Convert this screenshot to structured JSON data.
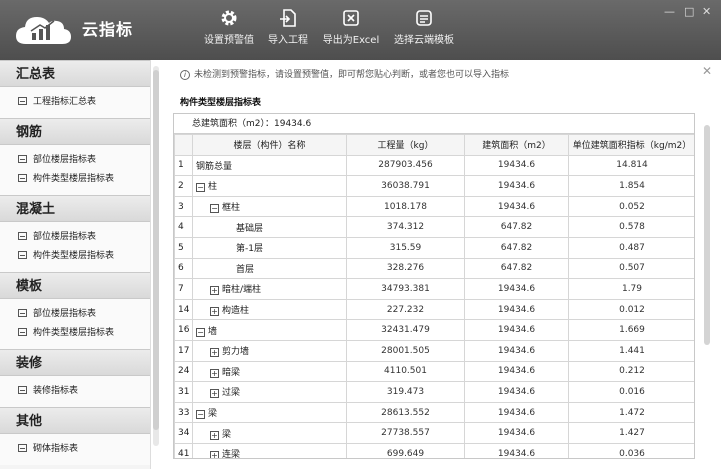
{
  "app": {
    "name": "云指标"
  },
  "toolbar": [
    {
      "label": "设置预警值",
      "icon": "gear-icon"
    },
    {
      "label": "导入工程",
      "icon": "import-icon"
    },
    {
      "label": "导出为Excel",
      "icon": "export-excel-icon"
    },
    {
      "label": "选择云端模板",
      "icon": "template-icon"
    }
  ],
  "sidebar": {
    "sections": [
      {
        "title": "汇总表",
        "items": [
          "工程指标汇总表"
        ]
      },
      {
        "title": "钢筋",
        "items": [
          "部位楼层指标表",
          "构件类型楼层指标表"
        ]
      },
      {
        "title": "混凝土",
        "items": [
          "部位楼层指标表",
          "构件类型楼层指标表"
        ]
      },
      {
        "title": "模板",
        "items": [
          "部位楼层指标表",
          "构件类型楼层指标表"
        ]
      },
      {
        "title": "装修",
        "items": [
          "装修指标表"
        ]
      },
      {
        "title": "其他",
        "items": [
          "砌体指标表"
        ]
      }
    ]
  },
  "main": {
    "notice": "未检测到预警指标，请设置预警值，即可帮您贴心判断，或者您也可以导入指标",
    "section_title": "构件类型楼层指标表",
    "total_area": "总建筑面积（m2）：19434.6",
    "table": {
      "headers": [
        "楼层（构件）名称",
        "工程量（kg）",
        "建筑面积（m2）",
        "单位建筑面积指标（kg/m2）"
      ],
      "rows": [
        {
          "idx": "1",
          "level": 0,
          "toggle": "",
          "name": "钢筋总量",
          "qty": "287903.456",
          "area": "19434.6",
          "index": "14.814"
        },
        {
          "idx": "2",
          "level": 0,
          "toggle": "−",
          "name": "柱",
          "qty": "36038.791",
          "area": "19434.6",
          "index": "1.854"
        },
        {
          "idx": "3",
          "level": 1,
          "toggle": "−",
          "name": "框柱",
          "qty": "1018.178",
          "area": "19434.6",
          "index": "0.052"
        },
        {
          "idx": "4",
          "level": 2,
          "toggle": "",
          "name": "基础层",
          "qty": "374.312",
          "area": "647.82",
          "index": "0.578"
        },
        {
          "idx": "5",
          "level": 2,
          "toggle": "",
          "name": "第-1层",
          "qty": "315.59",
          "area": "647.82",
          "index": "0.487"
        },
        {
          "idx": "6",
          "level": 2,
          "toggle": "",
          "name": "首层",
          "qty": "328.276",
          "area": "647.82",
          "index": "0.507"
        },
        {
          "idx": "7",
          "level": 1,
          "toggle": "+",
          "name": "暗柱/端柱",
          "qty": "34793.381",
          "area": "19434.6",
          "index": "1.79"
        },
        {
          "idx": "14",
          "level": 1,
          "toggle": "+",
          "name": "构造柱",
          "qty": "227.232",
          "area": "19434.6",
          "index": "0.012"
        },
        {
          "idx": "16",
          "level": 0,
          "toggle": "−",
          "name": "墙",
          "qty": "32431.479",
          "area": "19434.6",
          "index": "1.669"
        },
        {
          "idx": "17",
          "level": 1,
          "toggle": "+",
          "name": "剪力墙",
          "qty": "28001.505",
          "area": "19434.6",
          "index": "1.441"
        },
        {
          "idx": "24",
          "level": 1,
          "toggle": "+",
          "name": "暗梁",
          "qty": "4110.501",
          "area": "19434.6",
          "index": "0.212"
        },
        {
          "idx": "31",
          "level": 1,
          "toggle": "+",
          "name": "过梁",
          "qty": "319.473",
          "area": "19434.6",
          "index": "0.016"
        },
        {
          "idx": "33",
          "level": 0,
          "toggle": "−",
          "name": "梁",
          "qty": "28613.552",
          "area": "19434.6",
          "index": "1.472"
        },
        {
          "idx": "34",
          "level": 1,
          "toggle": "+",
          "name": "梁",
          "qty": "27738.557",
          "area": "19434.6",
          "index": "1.427"
        },
        {
          "idx": "41",
          "level": 1,
          "toggle": "+",
          "name": "连梁",
          "qty": "699.649",
          "area": "19434.6",
          "index": "0.036"
        }
      ]
    }
  }
}
